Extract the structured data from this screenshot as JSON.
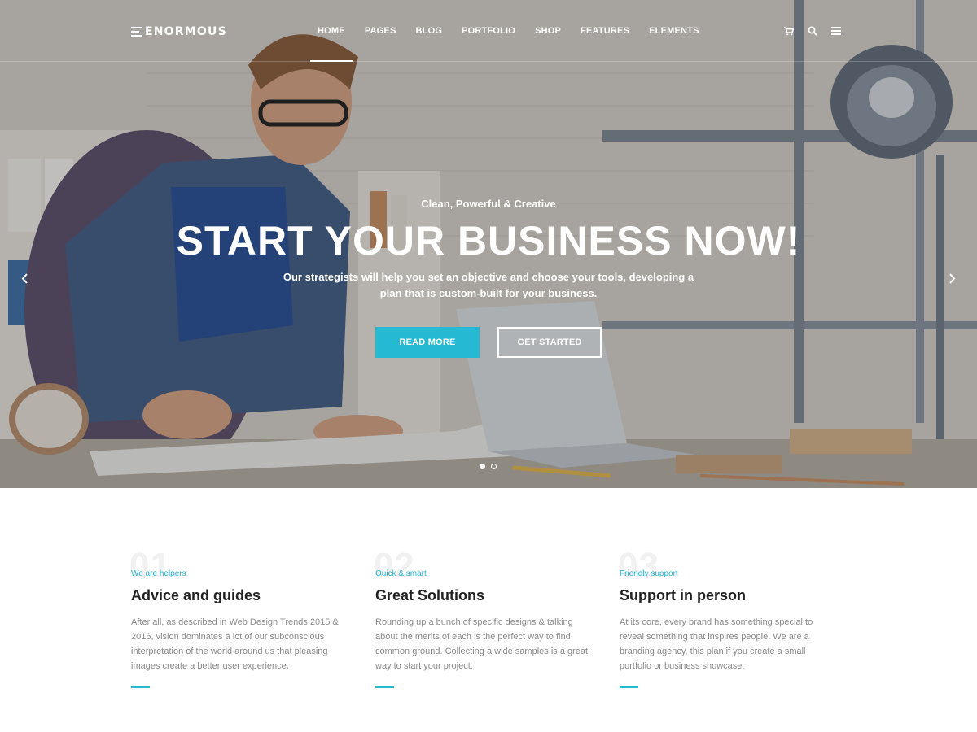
{
  "colors": {
    "accent": "#26b9d3",
    "hero_text": "#ffffff",
    "heading": "#222222",
    "body_text": "#8a8a8a"
  },
  "header": {
    "logo_text": "ENORMOUS",
    "nav": [
      {
        "label": "HOME",
        "active": true
      },
      {
        "label": "PAGES",
        "active": false
      },
      {
        "label": "BLOG",
        "active": false
      },
      {
        "label": "PORTFOLIO",
        "active": false
      },
      {
        "label": "SHOP",
        "active": false
      },
      {
        "label": "FEATURES",
        "active": false
      },
      {
        "label": "ELEMENTS",
        "active": false
      }
    ],
    "icons": [
      "cart-icon",
      "search-icon",
      "menu-icon"
    ]
  },
  "hero": {
    "subtitle": "Clean, Powerful & Creative",
    "title": "START YOUR BUSINESS NOW!",
    "description": "Our strategists will help you set an objective and choose your tools, developing a plan that is custom-built for your business.",
    "primary_button": "READ MORE",
    "secondary_button": "GET STARTED",
    "slides_total": 2,
    "active_slide": 1
  },
  "features": [
    {
      "number": "01.",
      "kicker": "We are helpers",
      "title": "Advice and guides",
      "text": "After all, as described in Web Design Trends 2015 & 2016, vision dominates a lot of our subconscious interpretation of the world around us that pleasing images create a better user experience."
    },
    {
      "number": "02.",
      "kicker": "Quick & smart",
      "title": "Great Solutions",
      "text": "Rounding up a bunch of specific designs & talking about the merits of each is the perfect way to find common ground. Collecting a wide samples is a great way to start your project."
    },
    {
      "number": "03.",
      "kicker": "Friendly support",
      "title": "Support in person",
      "text": "At its core, every brand has something special to reveal something that inspires people. We are a branding agency, this plan if you create a small portfolio or business showcase."
    }
  ]
}
